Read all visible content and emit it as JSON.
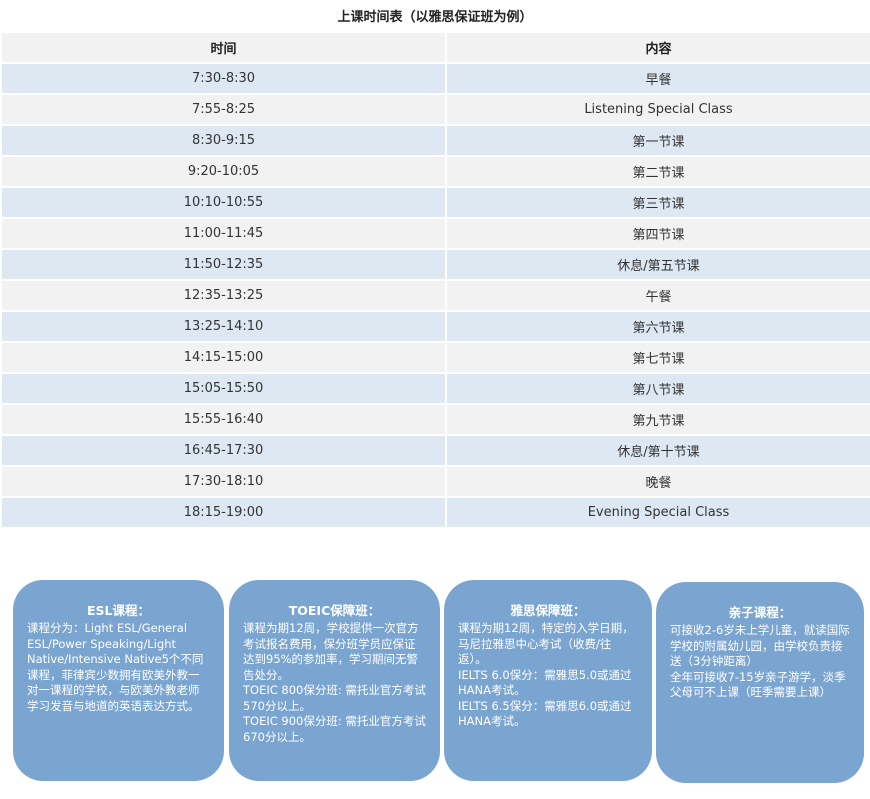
{
  "title": "上课时间表（以雅思保证班为例）",
  "table": {
    "headers": [
      "时间",
      "内容"
    ],
    "rows": [
      {
        "time": "7:30-8:30",
        "content": "早餐"
      },
      {
        "time": "7:55-8:25",
        "content": "Listening Special Class"
      },
      {
        "time": "8:30-9:15",
        "content": "第一节课"
      },
      {
        "time": "9:20-10:05",
        "content": "第二节课"
      },
      {
        "time": "10:10-10:55",
        "content": "第三节课"
      },
      {
        "time": "11:00-11:45",
        "content": "第四节课"
      },
      {
        "time": "11:50-12:35",
        "content": "休息/第五节课"
      },
      {
        "time": "12:35-13:25",
        "content": "午餐"
      },
      {
        "time": "13:25-14:10",
        "content": "第六节课"
      },
      {
        "time": "14:15-15:00",
        "content": "第七节课"
      },
      {
        "time": "15:05-15:50",
        "content": "第八节课"
      },
      {
        "time": "15:55-16:40",
        "content": "第九节课"
      },
      {
        "time": "16:45-17:30",
        "content": "休息/第十节课"
      },
      {
        "time": "17:30-18:10",
        "content": "晚餐"
      },
      {
        "time": "18:15-19:00",
        "content": "Evening Special Class"
      }
    ]
  },
  "cards": [
    {
      "title": "ESL课程：",
      "lines": [
        "课程分为：Light ESL/General ESL/Power Speaking/Light Native/Intensive Native5个不同课程，菲律宾少数拥有欧美外教一对一课程的学校，与欧美外教老师学习发音与地道的英语表达方式。"
      ]
    },
    {
      "title": "TOEIC保障班：",
      "lines": [
        "课程为期12周，学校提供一次官方考试报名费用，保分班学员应保证达到95%的参加率，学习期间无警告处分。",
        "TOEIC 800保分班: 需托业官方考试570分以上。",
        "TOEIC 900保分班: 需托业官方考试670分以上。"
      ]
    },
    {
      "title": "雅思保障班：",
      "lines": [
        "课程为期12周，特定的入学日期，马尼拉雅思中心考试（收费/往返）。",
        "IELTS 6.0保分：需雅思5.0或通过HANA考试。",
        "IELTS 6.5保分：需雅思6.0或通过HANA考试。"
      ]
    },
    {
      "title": "亲子课程：",
      "lines": [
        "可接收2-6岁未上学儿童，就读国际学校的附属幼儿园，由学校负责接送（3分钟距离）",
        "全年可接收7-15岁亲子游学，淡季父母可不上课（旺季需要上课）"
      ]
    }
  ]
}
